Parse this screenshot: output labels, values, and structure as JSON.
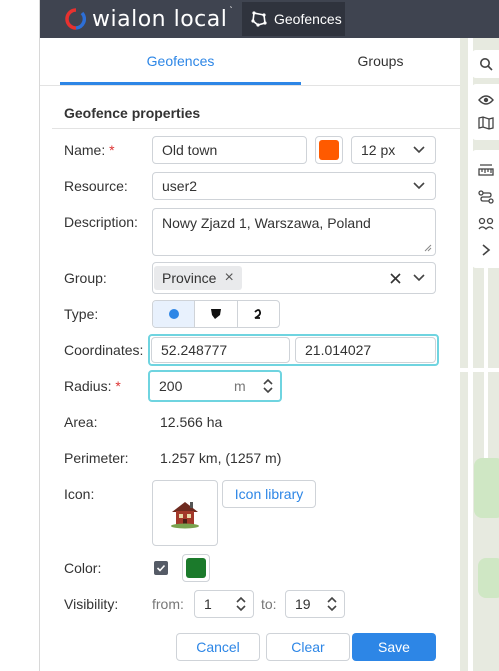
{
  "app": {
    "logo_text": "wialon local",
    "active_module": "Geofences",
    "colors": {
      "topbar": "#3f4450",
      "accent": "#2d86e6",
      "focus": "#6fd4e0",
      "logo_red": "#e7312f"
    }
  },
  "tabs": [
    {
      "label": "Geofences",
      "active": true
    },
    {
      "label": "Groups",
      "active": false
    }
  ],
  "properties": {
    "section_title": "Geofence properties",
    "name": {
      "label": "Name:",
      "required_mark": "*",
      "value": "Old town",
      "color": "#ff5a00",
      "line_width": "12 px"
    },
    "resource": {
      "label": "Resource:",
      "value": "user2"
    },
    "description": {
      "label": "Description:",
      "value": "Nowy Zjazd 1, Warszawa, Poland"
    },
    "group": {
      "label": "Group:",
      "chip": "Province",
      "chip_remove": "×",
      "clear": "×"
    },
    "type": {
      "label": "Type:",
      "options": [
        "circle-icon",
        "polygon-icon",
        "line-icon"
      ],
      "selected": "circle-icon"
    },
    "coordinates": {
      "label": "Coordinates:",
      "lat": "52.248777",
      "lon": "21.014027"
    },
    "radius": {
      "label": "Radius:",
      "required_mark": "*",
      "value": "200",
      "unit": "m"
    },
    "area": {
      "label": "Area:",
      "value": "12.566 ha"
    },
    "perimeter": {
      "label": "Perimeter:",
      "value": "1.257 km, (1257 m)"
    },
    "icon": {
      "label": "Icon:",
      "image": "house-icon",
      "library_button": "Icon library"
    },
    "color": {
      "label": "Color:",
      "checked": true,
      "value": "#1b7a2b"
    },
    "visibility": {
      "label": "Visibility:",
      "from_label": "from:",
      "from_value": "1",
      "to_label": "to:",
      "to_value": "19"
    }
  },
  "actions": {
    "cancel": "Cancel",
    "clear": "Clear",
    "save": "Save"
  },
  "map_tools": [
    "search-icon",
    "eye-icon",
    "map-layers-icon",
    "ruler-icon",
    "route-icon",
    "track-icon",
    "expand-icon"
  ]
}
